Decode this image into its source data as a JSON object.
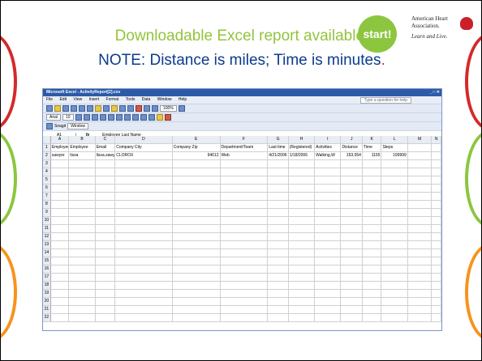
{
  "slide": {
    "headline_1": "Downloadable Excel report available",
    "headline_1_end": ".",
    "headline_2": "NOTE: Distance is miles; Time is minutes",
    "headline_2_end": ".",
    "start_logo": "start!",
    "aha_name": "American Heart Association.",
    "aha_tagline": "Learn and Live."
  },
  "excel": {
    "title": "Microsoft Excel - ActivityReport[2].csv",
    "menu": [
      "File",
      "Edit",
      "View",
      "Insert",
      "Format",
      "Tools",
      "Data",
      "Window",
      "Help"
    ],
    "ask_placeholder": "Type a question for help",
    "font_name": "Arial",
    "font_size": "10",
    "zoom": "100%",
    "snagit": "Snagit",
    "window_label": "Window",
    "name_box": "A1",
    "fx": "fx",
    "formula_value": "Employee Last Name",
    "columns": [
      "A",
      "B",
      "C",
      "D",
      "E",
      "F",
      "G",
      "H",
      "I",
      "J",
      "K",
      "L",
      "M",
      "N"
    ],
    "row_numbers": [
      "1",
      "2",
      "3",
      "4",
      "5",
      "6",
      "7",
      "8",
      "9",
      "10",
      "11",
      "12",
      "13",
      "14",
      "15",
      "16",
      "17",
      "18",
      "19",
      "20",
      "21",
      "22"
    ],
    "header_row": [
      "Employee",
      "Employee",
      "Email",
      "Company City",
      "Company Zip",
      "Department/Team",
      "Last time",
      "(Registered)",
      "Activities",
      "Distance",
      "Time",
      "Steps",
      "",
      ""
    ],
    "data_row": [
      "sawyer",
      "lissa",
      "lissa.sawy",
      "CLOROX",
      "94612",
      "Web",
      "4/21/2006",
      "1/18/2006",
      "Walking,W",
      "153.054",
      "1155",
      "199999",
      "",
      ""
    ]
  },
  "colors": {
    "green": "#92c43c",
    "blue": "#0b3b8c",
    "red": "#d42a2a",
    "orange": "#f7931e"
  }
}
